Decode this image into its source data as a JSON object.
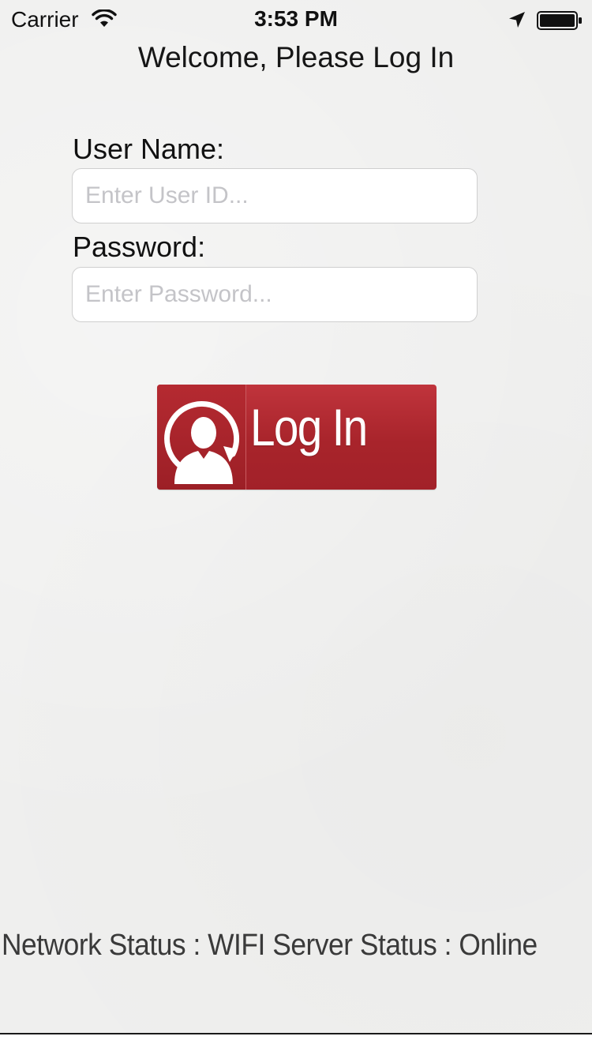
{
  "status_bar": {
    "carrier": "Carrier",
    "time": "3:53 PM",
    "icons": [
      "wifi-icon",
      "location-arrow-icon",
      "battery-icon"
    ]
  },
  "title": "Welcome, Please Log In",
  "form": {
    "username_label": "User Name:",
    "username_placeholder": "Enter User ID...",
    "username_value": "",
    "password_label": "Password:",
    "password_placeholder": "Enter Password...",
    "password_value": ""
  },
  "login_button": {
    "label": "Log In",
    "icon": "user-refresh-icon",
    "color": "#a8242b"
  },
  "footer": {
    "status_text": "Network Status : WIFI Server Status : Online"
  }
}
